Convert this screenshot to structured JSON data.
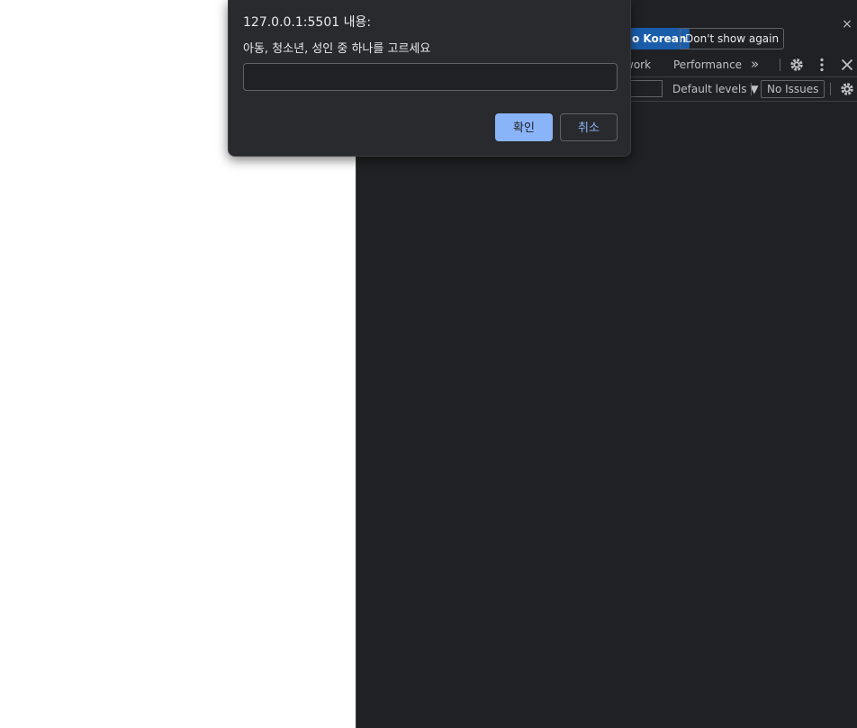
{
  "dialog": {
    "title": "127.0.0.1:5501 내용:",
    "message": "아동, 청소년, 성인 중 하나를 고르세요",
    "input_value": "",
    "ok_label": "확인",
    "cancel_label": "취소"
  },
  "devtools": {
    "infobar": {
      "language_button": "o Korean",
      "dont_show_again": "Don't show again",
      "close_icon": "close-icon"
    },
    "tabs": [
      {
        "label": "work"
      },
      {
        "label": "Performance"
      }
    ],
    "toolbar": {
      "default_levels": "Default levels ▼",
      "no_issues": "No Issues"
    }
  },
  "colors": {
    "devtools_bg": "#202124",
    "dialog_bg": "#292a2d",
    "accent": "#8ab4f8",
    "language_button_bg": "#1a5dab"
  }
}
